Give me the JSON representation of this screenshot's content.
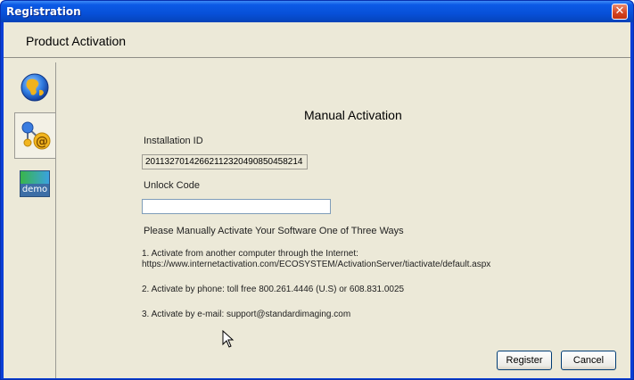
{
  "window": {
    "title": "Registration",
    "close_glyph": "✕"
  },
  "header": {
    "title": "Product Activation"
  },
  "sidebar": {
    "items": [
      {
        "icon": "globe-icon"
      },
      {
        "icon": "email-activation-icon"
      },
      {
        "icon": "demo-icon",
        "label": "demo"
      }
    ],
    "active_index": 1
  },
  "main": {
    "heading": "Manual Activation",
    "installation_id_label": "Installation ID",
    "installation_id_value": "20113270142662112320490850458214",
    "unlock_code_label": "Unlock Code",
    "unlock_code_value": "",
    "instructions_title": "Please Manually Activate Your Software One of Three Ways",
    "step1_line1": "1. Activate from another computer through the Internet:",
    "step1_line2": "https://www.internetactivation.com/ECOSYSTEM/ActivationServer/tiactivate/default.aspx",
    "step2": "2. Activate by phone: toll free 800.261.4446 (U.S)  or 608.831.0025",
    "step3": "3. Activate by e-mail: support@standardimaging.com"
  },
  "buttons": {
    "register": "Register",
    "cancel": "Cancel"
  },
  "colors": {
    "titlebar": "#0750d8",
    "client_bg": "#ece9d8",
    "close_button": "#d3431f"
  }
}
